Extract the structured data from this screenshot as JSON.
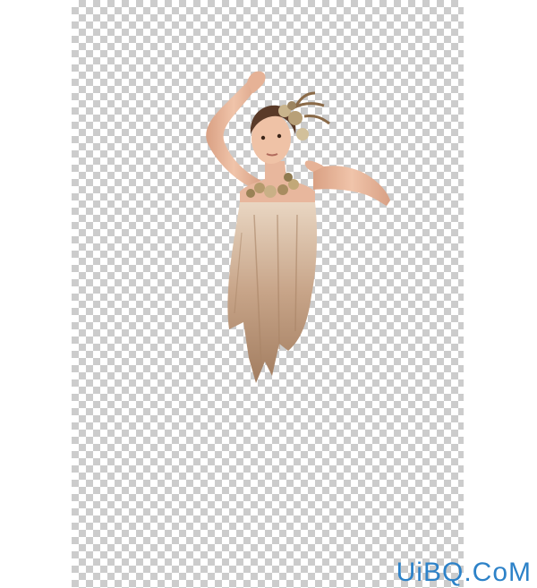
{
  "document": {
    "background": "transparent-checkerboard",
    "checker_colors": [
      "#ffffff",
      "#cccccc"
    ]
  },
  "subject": {
    "description_icon": "cutout-dancer-figure",
    "dress_color": "#c9a98a",
    "skin_color": "#e8b79d",
    "hair_color": "#5a3a28"
  },
  "watermark": {
    "text": "UiBQ.CoM",
    "color": "#2d82c8"
  }
}
